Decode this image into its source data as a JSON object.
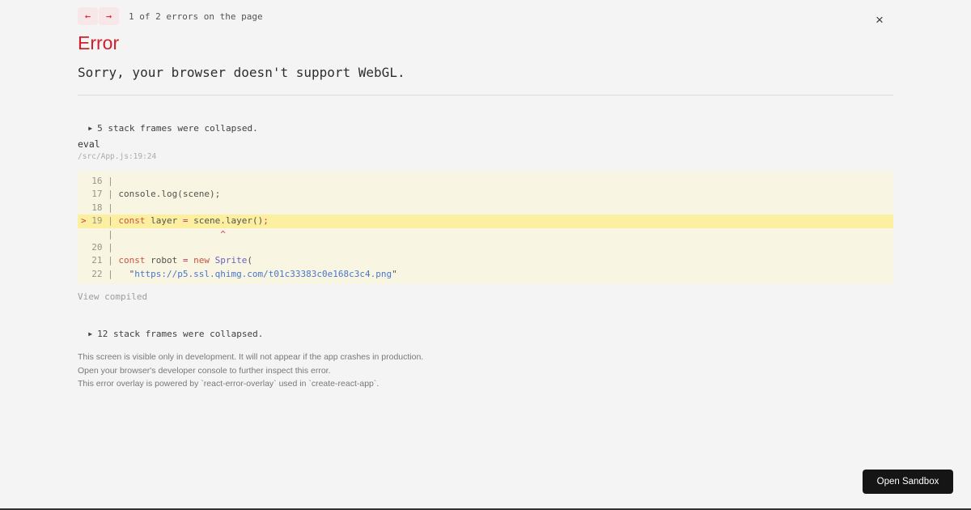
{
  "nav": {
    "prev": "←",
    "next": "→",
    "count": "1 of 2 errors on the page",
    "close": "×"
  },
  "error": {
    "title": "Error",
    "message": "Sorry, your browser doesn't support WebGL."
  },
  "stack": {
    "collapsed_top": {
      "marker": "▶",
      "label": "5 stack frames were collapsed."
    },
    "frame": {
      "function": "eval",
      "location": "/src/App.js:19:24"
    },
    "view_compiled": "View compiled",
    "collapsed_bottom": {
      "marker": "▶",
      "label": "12 stack frames were collapsed."
    }
  },
  "code": {
    "lines": [
      {
        "highlight": false,
        "tokens": [
          {
            "t": "  16 | ",
            "c": "gutter"
          }
        ]
      },
      {
        "highlight": false,
        "tokens": [
          {
            "t": "  17 | ",
            "c": "gutter"
          },
          {
            "t": "console.log(scene);",
            "c": "plain"
          }
        ]
      },
      {
        "highlight": false,
        "tokens": [
          {
            "t": "  18 | ",
            "c": "gutter"
          }
        ]
      },
      {
        "highlight": true,
        "tokens": [
          {
            "t": ">",
            "c": "marker"
          },
          {
            "t": " 19 | ",
            "c": "gutter"
          },
          {
            "t": "const",
            "c": "keyword"
          },
          {
            "t": " layer ",
            "c": "plain"
          },
          {
            "t": "=",
            "c": "operator"
          },
          {
            "t": " scene.layer()",
            "c": "plain"
          },
          {
            "t": ";",
            "c": "operator"
          }
        ]
      },
      {
        "highlight": false,
        "tokens": [
          {
            "t": "     | ",
            "c": "gutter"
          },
          {
            "t": "                   ^",
            "c": "caret"
          }
        ]
      },
      {
        "highlight": false,
        "tokens": [
          {
            "t": "  20 | ",
            "c": "gutter"
          }
        ]
      },
      {
        "highlight": false,
        "tokens": [
          {
            "t": "  21 | ",
            "c": "gutter"
          },
          {
            "t": "const",
            "c": "keyword"
          },
          {
            "t": " robot ",
            "c": "plain"
          },
          {
            "t": "=",
            "c": "operator"
          },
          {
            "t": " ",
            "c": "plain"
          },
          {
            "t": "new",
            "c": "keyword"
          },
          {
            "t": " ",
            "c": "plain"
          },
          {
            "t": "Sprite",
            "c": "class"
          },
          {
            "t": "(",
            "c": "plain"
          }
        ]
      },
      {
        "highlight": false,
        "tokens": [
          {
            "t": "  22 | ",
            "c": "gutter"
          },
          {
            "t": "  \"",
            "c": "plain"
          },
          {
            "t": "https://p5.ssl.qhimg.com/t01c33383c0e168c3c4.png",
            "c": "string"
          },
          {
            "t": "\"",
            "c": "plain"
          }
        ]
      }
    ]
  },
  "footer": {
    "lines": [
      "This screen is visible only in development. It will not appear if the app crashes in production.",
      "Open your browser's developer console to further inspect this error.",
      "This error overlay is powered by `react-error-overlay` used in `create-react-app`."
    ]
  },
  "sandbox": {
    "open_label": "Open Sandbox"
  }
}
